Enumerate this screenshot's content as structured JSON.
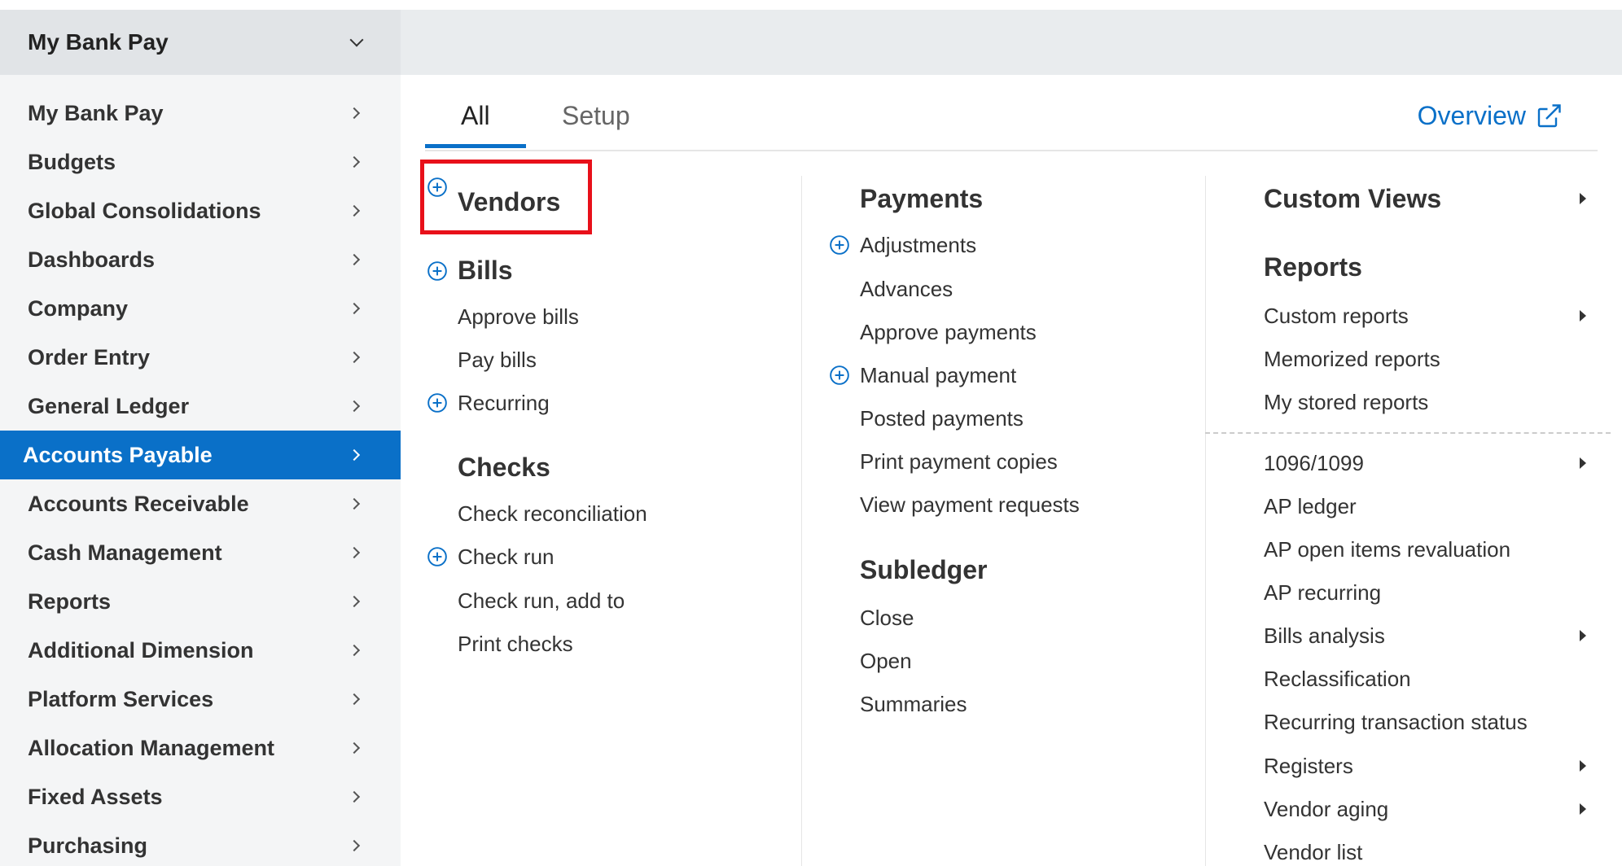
{
  "sidebar": {
    "header_title": "My Bank Pay",
    "items": [
      {
        "label": "My Bank Pay"
      },
      {
        "label": "Budgets"
      },
      {
        "label": "Global Consolidations"
      },
      {
        "label": "Dashboards"
      },
      {
        "label": "Company"
      },
      {
        "label": "Order Entry"
      },
      {
        "label": "General Ledger"
      },
      {
        "label": "Accounts Payable"
      },
      {
        "label": "Accounts Receivable"
      },
      {
        "label": "Cash Management"
      },
      {
        "label": "Reports"
      },
      {
        "label": "Additional Dimension"
      },
      {
        "label": "Platform Services"
      },
      {
        "label": "Allocation Management"
      },
      {
        "label": "Fixed Assets"
      },
      {
        "label": "Purchasing"
      }
    ],
    "active_item": "Accounts Payable"
  },
  "tabs": {
    "all": "All",
    "setup": "Setup",
    "overview": "Overview"
  },
  "col1": {
    "vendors": "Vendors",
    "bills": "Bills",
    "approve_bills": "Approve bills",
    "pay_bills": "Pay bills",
    "recurring": "Recurring",
    "checks": "Checks",
    "check_reconciliation": "Check reconciliation",
    "check_run": "Check run",
    "check_run_add_to": "Check run, add to",
    "print_checks": "Print checks"
  },
  "col2": {
    "payments": "Payments",
    "adjustments": "Adjustments",
    "advances": "Advances",
    "approve_payments": "Approve payments",
    "manual_payment": "Manual payment",
    "posted_payments": "Posted payments",
    "print_payment_copies": "Print payment copies",
    "view_payment_requests": "View payment requests",
    "subledger": "Subledger",
    "close": "Close",
    "open": "Open",
    "summaries": "Summaries"
  },
  "col3": {
    "custom_views": "Custom Views",
    "reports": "Reports",
    "custom_reports": "Custom reports",
    "memorized_reports": "Memorized reports",
    "my_stored_reports": "My stored reports",
    "f1096_1099": "1096/1099",
    "ap_ledger": "AP ledger",
    "ap_open_items_revaluation": "AP open items revaluation",
    "ap_recurring": "AP recurring",
    "bills_analysis": "Bills analysis",
    "reclassification": "Reclassification",
    "recurring_transaction_status": "Recurring transaction status",
    "registers": "Registers",
    "vendor_aging": "Vendor aging",
    "vendor_list": "Vendor list"
  },
  "colors": {
    "accent": "#0a70c8",
    "highlight": "#e8101a",
    "sidebar_bg": "#f4f5f6",
    "sidebar_header_bg": "#e1e4e7"
  }
}
